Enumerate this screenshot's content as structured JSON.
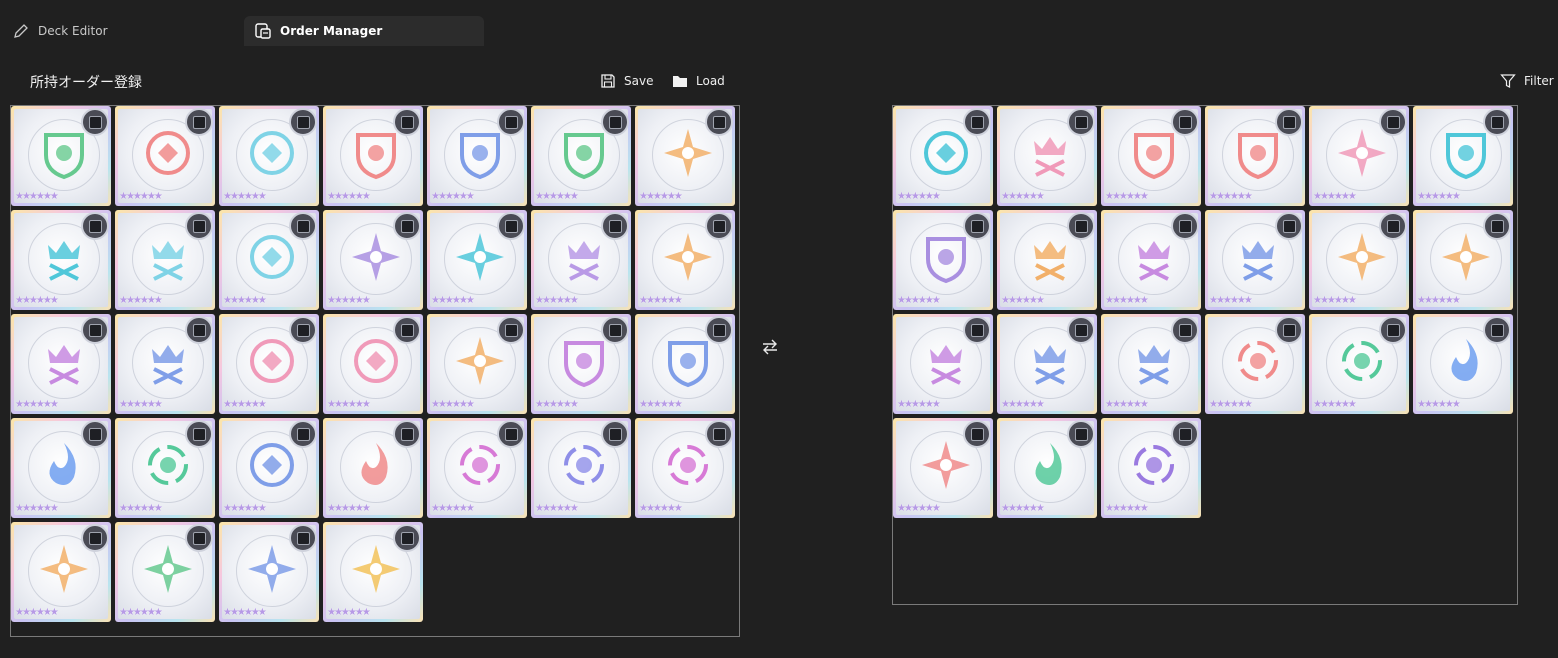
{
  "tabs": [
    {
      "label": "Deck Editor",
      "icon": "pencil-icon",
      "active": false
    },
    {
      "label": "Order Manager",
      "icon": "order-manager-icon",
      "active": true
    }
  ],
  "section_title": "所持オーダー登録",
  "toolbar": {
    "save_label": "Save",
    "load_label": "Load",
    "filter_label": "Filter"
  },
  "owned_orders": [
    {
      "emblem": "phoenix-crest",
      "color": "#66c98f",
      "rarity": 6
    },
    {
      "emblem": "phoenix",
      "color": "#f08b8b",
      "rarity": 6
    },
    {
      "emblem": "clock-arrows",
      "color": "#7fd3e6",
      "rarity": 6
    },
    {
      "emblem": "phoenix-shield",
      "color": "#f08b8b",
      "rarity": 6
    },
    {
      "emblem": "trident-shield",
      "color": "#7f9ee8",
      "rarity": 6
    },
    {
      "emblem": "wing-shield",
      "color": "#66c98f",
      "rarity": 6
    },
    {
      "emblem": "star-burst",
      "color": "#f2b06a",
      "rarity": 6
    },
    {
      "emblem": "crown-machine",
      "color": "#4fc7d9",
      "rarity": 6
    },
    {
      "emblem": "crown-cards",
      "color": "#7fd3e6",
      "rarity": 6
    },
    {
      "emblem": "cards-cycle",
      "color": "#7fd3e6",
      "rarity": 6
    },
    {
      "emblem": "lotus-star",
      "color": "#a98fe0",
      "rarity": 6
    },
    {
      "emblem": "sun-gear",
      "color": "#4fc7d9",
      "rarity": 6
    },
    {
      "emblem": "crown-swords",
      "color": "#b99ae6",
      "rarity": 6
    },
    {
      "emblem": "crown-star",
      "color": "#f2b06a",
      "rarity": 6
    },
    {
      "emblem": "crown-spiral",
      "color": "#c78ae0",
      "rarity": 6
    },
    {
      "emblem": "crown-drop",
      "color": "#7f9ee8",
      "rarity": 6
    },
    {
      "emblem": "crossed-swords",
      "color": "#f09ab9",
      "rarity": 6
    },
    {
      "emblem": "hexagons",
      "color": "#f09ab9",
      "rarity": 6
    },
    {
      "emblem": "crown-shield-star",
      "color": "#f2b06a",
      "rarity": 6
    },
    {
      "emblem": "crown-shield-spiral",
      "color": "#c78ae0",
      "rarity": 6
    },
    {
      "emblem": "crown-shield-drop",
      "color": "#7f9ee8",
      "rarity": 6
    },
    {
      "emblem": "wave-flame",
      "color": "#6f9ff0",
      "rarity": 6
    },
    {
      "emblem": "tornado",
      "color": "#55c99a",
      "rarity": 6
    },
    {
      "emblem": "crystal",
      "color": "#7f9ee8",
      "rarity": 6
    },
    {
      "emblem": "flame-bloom",
      "color": "#f08b8b",
      "rarity": 6
    },
    {
      "emblem": "vortex",
      "color": "#d77ad6",
      "rarity": 6
    },
    {
      "emblem": "vortex",
      "color": "#8f8fe8",
      "rarity": 6
    },
    {
      "emblem": "vortex",
      "color": "#d77ad6",
      "rarity": 6
    },
    {
      "emblem": "eye-star",
      "color": "#f2b06a",
      "rarity": 6
    },
    {
      "emblem": "gem-star",
      "color": "#66c98f",
      "rarity": 6
    },
    {
      "emblem": "gem-star",
      "color": "#7f9ee8",
      "rarity": 6
    },
    {
      "emblem": "gem-star",
      "color": "#f2c25a",
      "rarity": 6
    }
  ],
  "deck_orders": [
    {
      "emblem": "gear-device",
      "color": "#4fc7d9",
      "rarity": 6
    },
    {
      "emblem": "fleur-crown",
      "color": "#f09ab9",
      "rarity": 6
    },
    {
      "emblem": "crown-shield-slash",
      "color": "#f08b8b",
      "rarity": 6
    },
    {
      "emblem": "crown-badge",
      "color": "#f08b8b",
      "rarity": 6
    },
    {
      "emblem": "compass-star",
      "color": "#f09ab9",
      "rarity": 6
    },
    {
      "emblem": "flower-seal",
      "color": "#4fc7d9",
      "rarity": 6
    },
    {
      "emblem": "hex-crest",
      "color": "#a98fe0",
      "rarity": 6
    },
    {
      "emblem": "crown-swords",
      "color": "#f2b06a",
      "rarity": 6
    },
    {
      "emblem": "crown-spiral",
      "color": "#c78ae0",
      "rarity": 6
    },
    {
      "emblem": "crown-drop",
      "color": "#7f9ee8",
      "rarity": 6
    },
    {
      "emblem": "orbit-star",
      "color": "#f2b06a",
      "rarity": 6
    },
    {
      "emblem": "crown-star",
      "color": "#f2b06a",
      "rarity": 6
    },
    {
      "emblem": "crown-spiral",
      "color": "#c78ae0",
      "rarity": 6
    },
    {
      "emblem": "crown-drop",
      "color": "#7f9ee8",
      "rarity": 6
    },
    {
      "emblem": "crown-trident",
      "color": "#7f9ee8",
      "rarity": 6
    },
    {
      "emblem": "fire-swirl",
      "color": "#f08b8b",
      "rarity": 6
    },
    {
      "emblem": "wind-swirl",
      "color": "#55c99a",
      "rarity": 6
    },
    {
      "emblem": "fountain",
      "color": "#6f9ff0",
      "rarity": 6
    },
    {
      "emblem": "sun-crest",
      "color": "#f08b8b",
      "rarity": 6
    },
    {
      "emblem": "leaf-flame",
      "color": "#55c99a",
      "rarity": 6
    },
    {
      "emblem": "vortex",
      "color": "#9a7ae0",
      "rarity": 6
    }
  ]
}
